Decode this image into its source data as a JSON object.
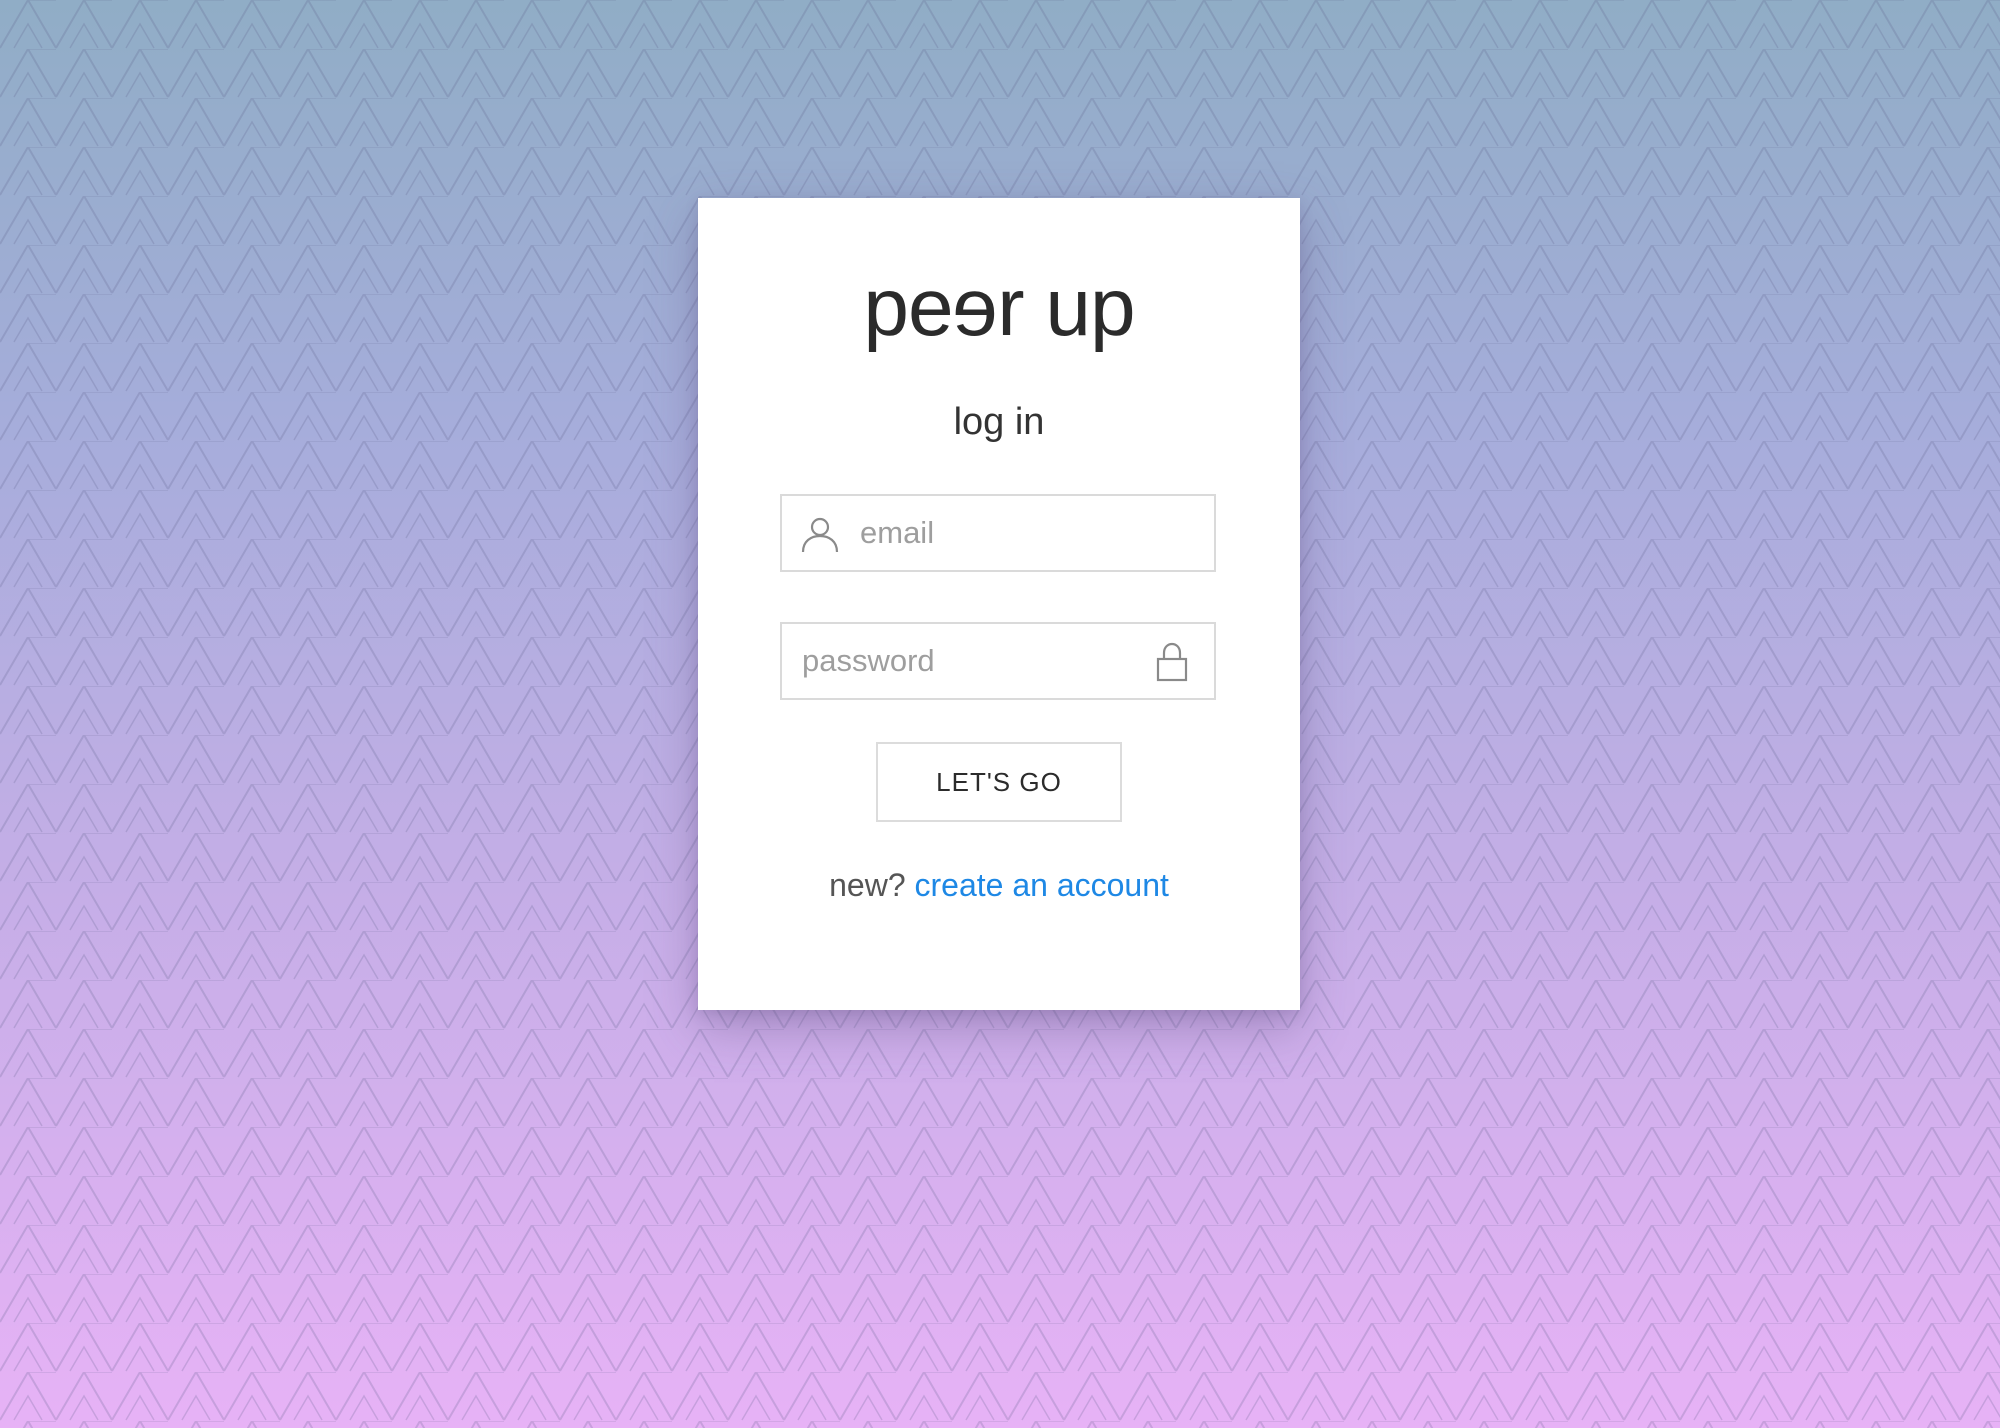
{
  "app": {
    "logo_part1": "pe",
    "logo_flipped": "e",
    "logo_part2": "r up"
  },
  "login": {
    "heading": "log in",
    "email_placeholder": "email",
    "email_value": "",
    "password_placeholder": "password",
    "password_value": "",
    "submit_label": "LET'S GO",
    "signup_prompt": "new?",
    "signup_link": "create an account"
  },
  "icons": {
    "email": "user-icon",
    "password": "lock-icon"
  },
  "colors": {
    "link": "#1e88e5",
    "background_top": "#90adc6",
    "background_bottom": "#e7b2f6",
    "text": "#2b2b2b"
  }
}
